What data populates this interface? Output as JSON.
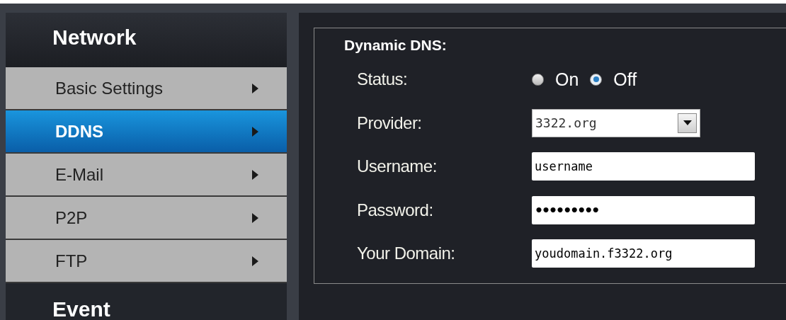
{
  "sidebar": {
    "title": "Network",
    "items": [
      {
        "label": "Basic Settings",
        "selected": false
      },
      {
        "label": "DDNS",
        "selected": true
      },
      {
        "label": "E-Mail",
        "selected": false
      },
      {
        "label": "P2P",
        "selected": false
      },
      {
        "label": "FTP",
        "selected": false
      }
    ],
    "next_section": "Event"
  },
  "panel": {
    "title": "Dynamic DNS:",
    "rows": [
      {
        "kind": "radio",
        "label": "Status:",
        "options": [
          {
            "label": "On",
            "selected": false
          },
          {
            "label": "Off",
            "selected": true
          }
        ]
      },
      {
        "kind": "select",
        "label": "Provider:",
        "value": "3322.org"
      },
      {
        "kind": "text",
        "label": "Username:",
        "value": "username"
      },
      {
        "kind": "password",
        "label": "Password:",
        "value": "•••••••••"
      },
      {
        "kind": "text",
        "label": "Your Domain:",
        "value": "youdomain.f3322.org"
      }
    ]
  }
}
